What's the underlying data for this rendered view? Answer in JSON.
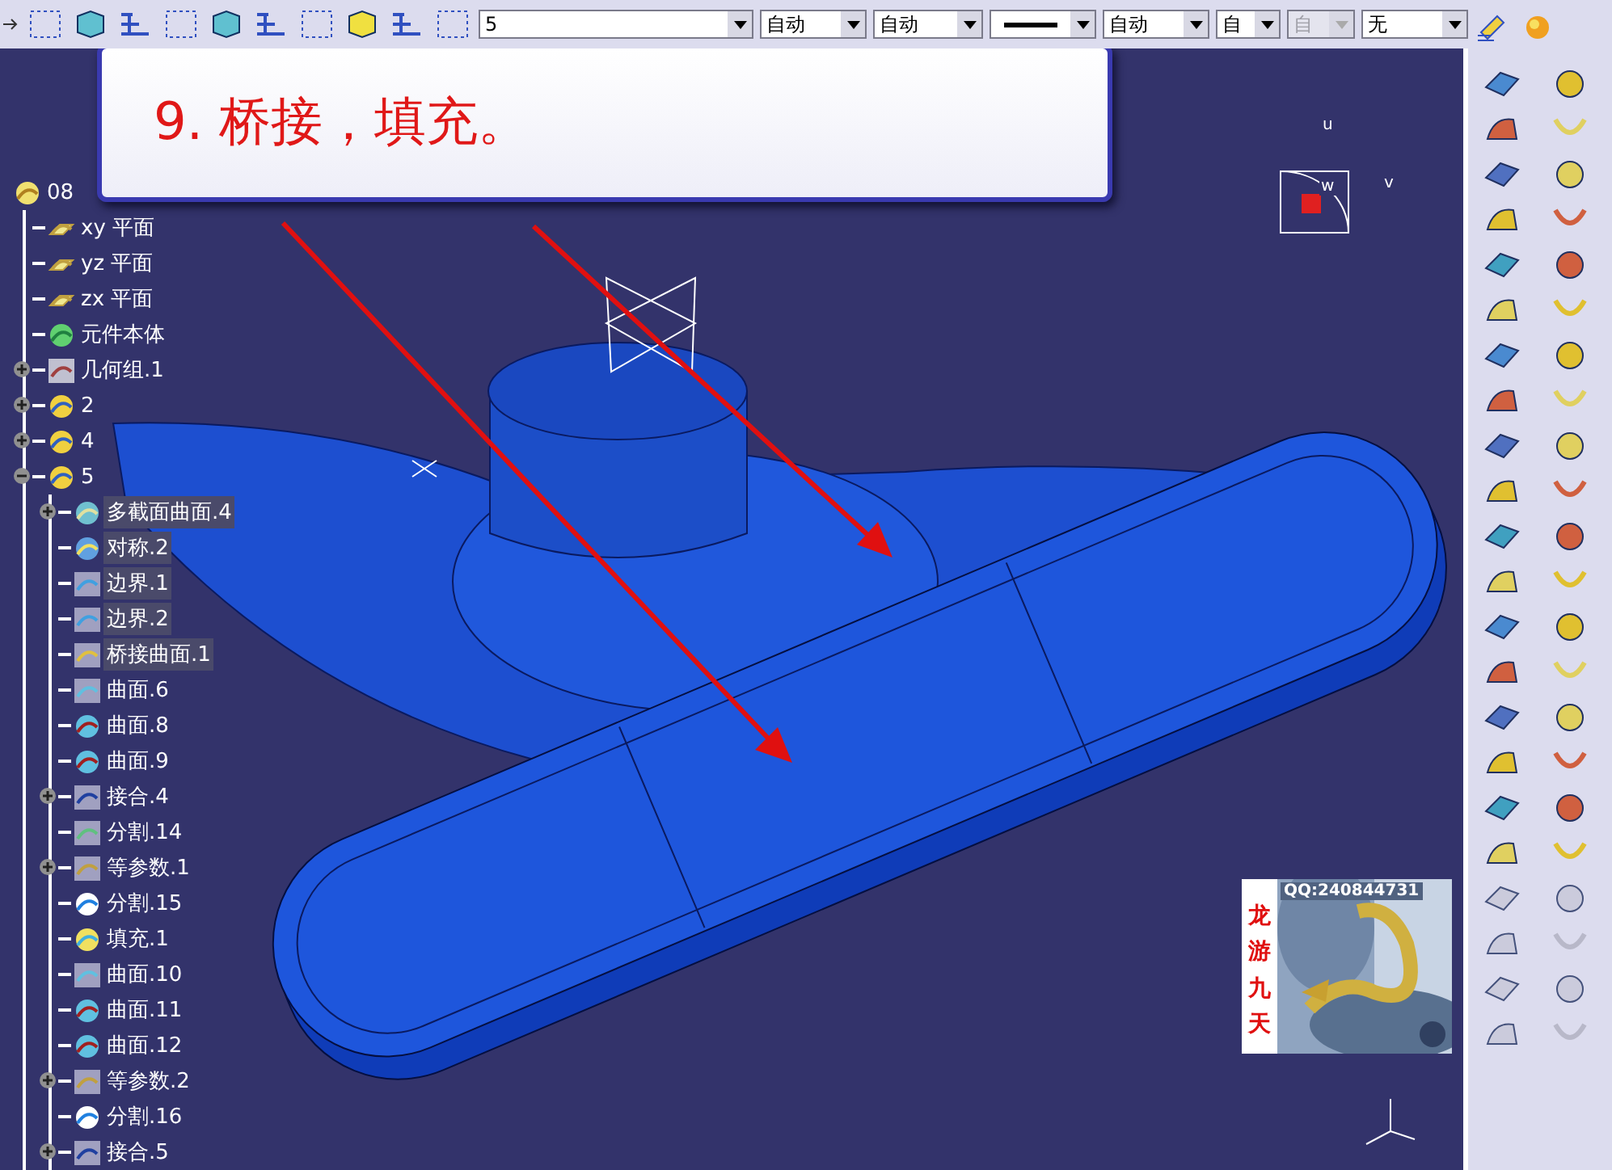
{
  "toolbar": {
    "combos": [
      {
        "kind": "text",
        "value": "5",
        "disabled": false
      },
      {
        "kind": "text",
        "value": "自动",
        "disabled": false
      },
      {
        "kind": "text",
        "value": "自动",
        "disabled": false
      },
      {
        "kind": "line",
        "disabled": false
      },
      {
        "kind": "text",
        "value": "自动",
        "disabled": false
      },
      {
        "kind": "text",
        "value": "自",
        "disabled": false
      },
      {
        "kind": "text",
        "value": "自",
        "disabled": true
      },
      {
        "kind": "text",
        "value": "无",
        "disabled": false
      }
    ]
  },
  "callout": {
    "text": "9. 桥接，填充。"
  },
  "tree": {
    "items": [
      {
        "label": "08",
        "kind": "part",
        "selected": false,
        "children": [
          {
            "label": "xy 平面",
            "kind": "plane",
            "selected": false
          },
          {
            "label": "yz 平面",
            "kind": "plane",
            "selected": false
          },
          {
            "label": "zx 平面",
            "kind": "plane",
            "selected": false
          },
          {
            "label": "元件本体",
            "kind": "body",
            "selected": false
          },
          {
            "label": "几何组.1",
            "kind": "geoset",
            "selected": false,
            "expanded": false
          },
          {
            "label": "2",
            "kind": "hybrid",
            "selected": false,
            "expanded": false
          },
          {
            "label": "4",
            "kind": "hybrid",
            "selected": false,
            "expanded": false
          },
          {
            "label": "5",
            "kind": "hybrid",
            "selected": false,
            "expanded": true,
            "children": [
              {
                "label": "多截面曲面.4",
                "kind": "loft",
                "selected": true,
                "expanded": false
              },
              {
                "label": "对称.2",
                "kind": "symmetry",
                "selected": true
              },
              {
                "label": "边界.1",
                "kind": "boundary",
                "selected": true
              },
              {
                "label": "边界.2",
                "kind": "boundary",
                "selected": true
              },
              {
                "label": "桥接曲面.1",
                "kind": "blend",
                "selected": true
              },
              {
                "label": "曲面.6",
                "kind": "surface",
                "selected": false
              },
              {
                "label": "曲面.8",
                "kind": "extrude",
                "selected": false
              },
              {
                "label": "曲面.9",
                "kind": "extrude",
                "selected": false
              },
              {
                "label": "接合.4",
                "kind": "join",
                "selected": false,
                "expanded": false
              },
              {
                "label": "分割.14",
                "kind": "split",
                "selected": false
              },
              {
                "label": "等参数.1",
                "kind": "isopar",
                "selected": false,
                "expanded": false
              },
              {
                "label": "分割.15",
                "kind": "trim",
                "selected": false
              },
              {
                "label": "填充.1",
                "kind": "fill",
                "selected": false
              },
              {
                "label": "曲面.10",
                "kind": "surface",
                "selected": false
              },
              {
                "label": "曲面.11",
                "kind": "extrude",
                "selected": false
              },
              {
                "label": "曲面.12",
                "kind": "extrude",
                "selected": false
              },
              {
                "label": "等参数.2",
                "kind": "isopar",
                "selected": false,
                "expanded": false
              },
              {
                "label": "分割.16",
                "kind": "trim",
                "selected": false
              },
              {
                "label": "接合.5",
                "kind": "join",
                "selected": false,
                "expanded": false
              }
            ]
          }
        ]
      }
    ]
  },
  "compass": {
    "labels": [
      "u",
      "v",
      "w"
    ]
  },
  "signature": {
    "name": "龙游九天",
    "contact": "QQ:240844731"
  }
}
